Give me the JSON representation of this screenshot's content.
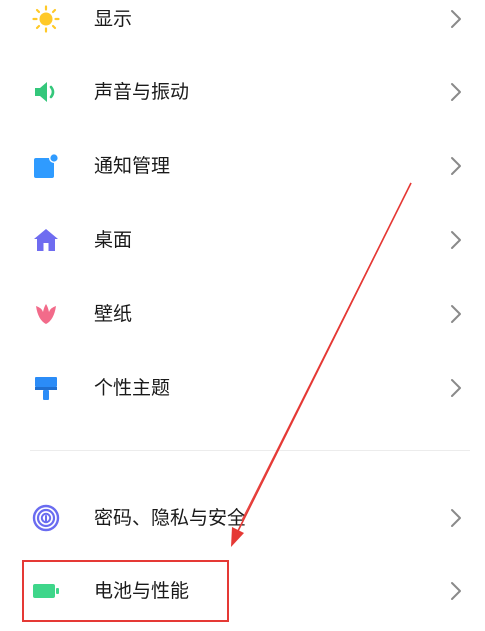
{
  "settings": {
    "items": [
      {
        "label": "显示",
        "icon": "sun-icon"
      },
      {
        "label": "声音与振动",
        "icon": "speaker-icon"
      },
      {
        "label": "通知管理",
        "icon": "notification-icon"
      },
      {
        "label": "桌面",
        "icon": "home-icon"
      },
      {
        "label": "壁纸",
        "icon": "tulip-icon"
      },
      {
        "label": "个性主题",
        "icon": "brush-icon"
      },
      {
        "label": "密码、隐私与安全",
        "icon": "fingerprint-icon"
      },
      {
        "label": "电池与性能",
        "icon": "battery-icon"
      }
    ]
  },
  "colors": {
    "annotation": "#e53935",
    "sun": "#ffc928",
    "speaker": "#34c77b",
    "notification": "#2f9bff",
    "home": "#6f6cf0",
    "tulip": "#f26b8a",
    "brush": "#2b8cf7",
    "fingerprint": "#6a6cf0",
    "battery": "#3ed68a"
  }
}
